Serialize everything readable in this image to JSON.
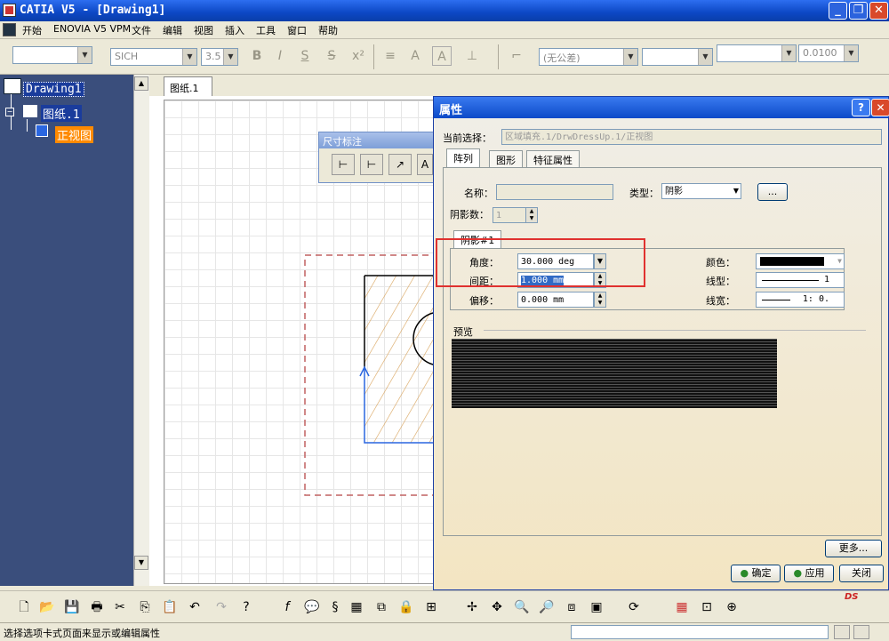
{
  "window": {
    "title": "CATIA V5 - [Drawing1]"
  },
  "menu": [
    "开始",
    "ENOVIA V5 VPM",
    "文件",
    "编辑",
    "视图",
    "插入",
    "工具",
    "窗口",
    "帮助"
  ],
  "toolbar": {
    "font_name": "SICH",
    "font_size": "3.5",
    "tolerance": "(无公差)",
    "precision": "0.0100"
  },
  "tree": {
    "root": "Drawing1",
    "sheet": "图纸.1",
    "view": "正视图"
  },
  "tab": {
    "label": "图纸.1"
  },
  "dim_toolbar": {
    "title": "尺寸标注"
  },
  "dialog": {
    "title": "属性",
    "help": "?",
    "current_selection_label": "当前选择：",
    "current_selection_value": "区域填充.1/DrwDressUp.1/正视图",
    "tabs": [
      "阵列",
      "图形",
      "特征属性"
    ],
    "name_label": "名称：",
    "name_value": "",
    "type_label": "类型：",
    "type_value": "阴影",
    "more_dots": "...",
    "hatch_count_label": "阴影数：",
    "hatch_count_value": "1",
    "subtab": "阴影#1",
    "angle_label": "角度：",
    "angle_value": "30.000 deg",
    "spacing_label": "间距：",
    "spacing_value": "1.000 mm",
    "offset_label": "偏移：",
    "offset_value": "0.000 mm",
    "color_label": "颜色：",
    "linetype_label": "线型：",
    "linetype_value": "1",
    "linewidth_label": "线宽：",
    "linewidth_value": "1: 0.",
    "preview_label": "预览",
    "more_button": "更多...",
    "ok_button": "确定",
    "apply_button": "应用",
    "close_button": "关闭"
  },
  "status": {
    "text": "选择选项卡式页面来显示或编辑属性"
  },
  "colors": {
    "tree_bg": "#3a4e7c",
    "highlight_box": "#e0312f",
    "view_highlight": "#ff8a00"
  }
}
